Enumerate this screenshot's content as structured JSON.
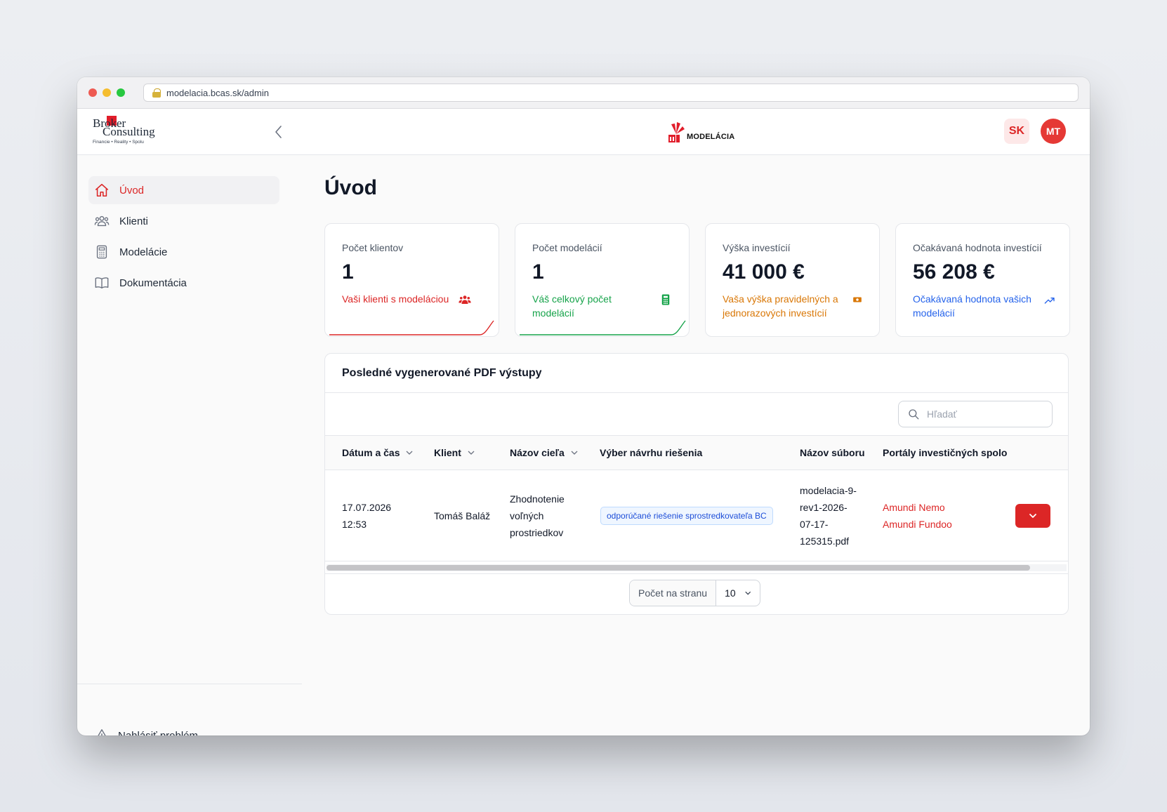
{
  "browser": {
    "url": "modelacia.bcas.sk/admin"
  },
  "header": {
    "brand_left_line1": "Broker",
    "brand_left_line2": "Consulting",
    "brand_left_tagline": "Financie • Reality • Spolu",
    "brand_center": "MODELÁCIA",
    "language": "SK",
    "user_initials": "MT"
  },
  "sidebar": {
    "items": [
      {
        "label": "Úvod",
        "icon": "home-icon",
        "active": true
      },
      {
        "label": "Klienti",
        "icon": "users-icon",
        "active": false
      },
      {
        "label": "Modelácie",
        "icon": "calculator-icon",
        "active": false
      },
      {
        "label": "Dokumentácia",
        "icon": "book-icon",
        "active": false
      }
    ],
    "report_label": "Nahlásiť problém"
  },
  "page": {
    "title": "Úvod"
  },
  "stats": [
    {
      "label": "Počet klientov",
      "value": "1",
      "desc": "Vaši klienti s modeláciou",
      "color": "#dc2626",
      "icon": "users-icon"
    },
    {
      "label": "Počet modelácií",
      "value": "1",
      "desc": "Váš celkový počet modelácií",
      "color": "#16a34a",
      "icon": "calculator-icon"
    },
    {
      "label": "Výška investícií",
      "value": "41 000 €",
      "desc": "Vaša výška pravidelných a jednorazových investícií",
      "color": "#d97706",
      "icon": "money-icon"
    },
    {
      "label": "Očakávaná hodnota investícií",
      "value": "56 208 €",
      "desc": "Očakávaná hodnota vašich modelácií",
      "color": "#2563eb",
      "icon": "trending-up-icon"
    }
  ],
  "table": {
    "title": "Posledné vygenerované PDF výstupy",
    "search_placeholder": "Hľadať",
    "columns": [
      {
        "label": "Dátum a čas",
        "sortable": true
      },
      {
        "label": "Klient",
        "sortable": true
      },
      {
        "label": "Názov cieľa",
        "sortable": true
      },
      {
        "label": "Výber návrhu riešenia",
        "sortable": false
      },
      {
        "label": "Názov súboru",
        "sortable": false
      },
      {
        "label": "Portály investičných spolo",
        "sortable": false
      }
    ],
    "rows": [
      {
        "date_line1": "17.07.2026",
        "date_line2": "12:53",
        "client": "Tomáš Baláž",
        "goal_line1": "Zhodnotenie",
        "goal_line2": "voľných",
        "goal_line3": "prostriedkov",
        "solution": "odporúčané riešenie sprostredkovateľa BC",
        "file_line1": "modelacia-9-",
        "file_line2": "rev1-2026-",
        "file_line3": "07-17-",
        "file_line4": "125315.pdf",
        "portal1": "Amundi Nemo",
        "portal2": "Amundi Fundoo"
      }
    ],
    "per_page_label": "Počet na stranu",
    "per_page_value": "10"
  }
}
